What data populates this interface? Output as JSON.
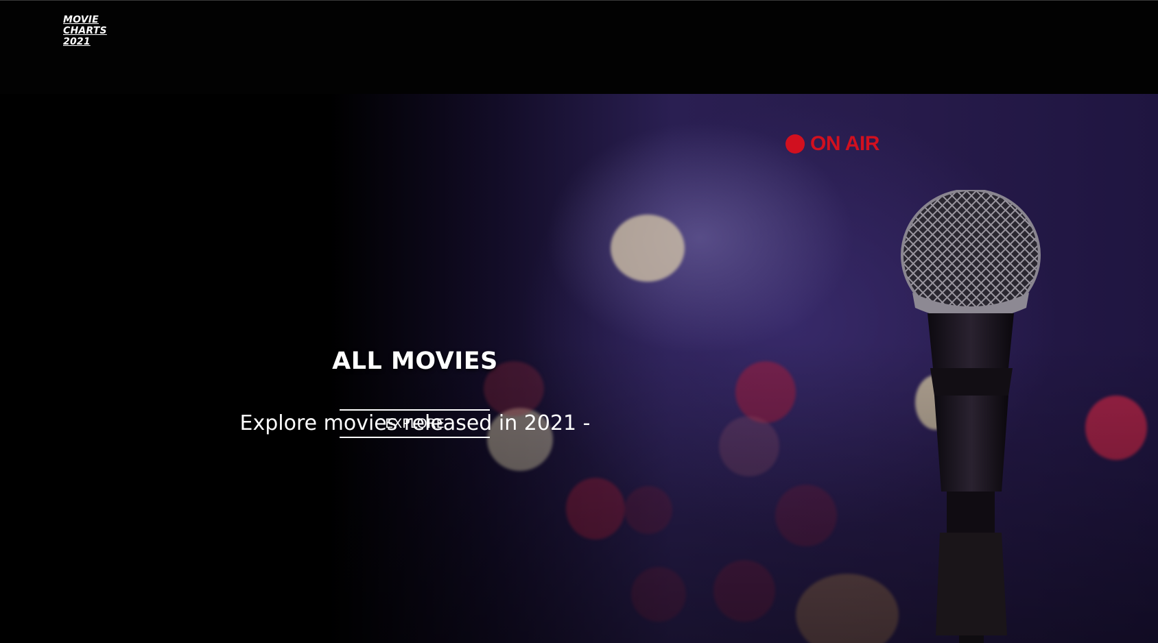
{
  "logo": {
    "line1": "MOVIE",
    "line2": "CHARTS",
    "line3": "2021"
  },
  "hero": {
    "badge_text": "ON AIR",
    "title": "ALL MOVIES",
    "subtitle": "Explore movies released in 2021 -",
    "button_label": "EXPLORE"
  },
  "colors": {
    "background": "#000000",
    "accent_red": "#d1101f",
    "text": "#ffffff"
  }
}
